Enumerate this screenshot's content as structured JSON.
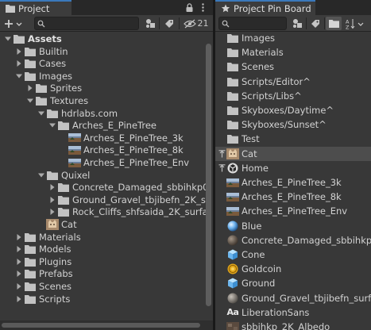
{
  "project": {
    "tab_title": "Project",
    "visibility_count": "21",
    "tree": [
      {
        "label": "Assets",
        "depth": 0,
        "expanded": true,
        "bold": true,
        "icon": "folder"
      },
      {
        "label": "Builtin",
        "depth": 1,
        "expanded": false,
        "icon": "folder"
      },
      {
        "label": "Cases",
        "depth": 1,
        "expanded": false,
        "icon": "folder"
      },
      {
        "label": "Images",
        "depth": 1,
        "expanded": true,
        "icon": "folder"
      },
      {
        "label": "Sprites",
        "depth": 2,
        "expanded": false,
        "icon": "folder"
      },
      {
        "label": "Textures",
        "depth": 2,
        "expanded": true,
        "icon": "folder"
      },
      {
        "label": "hdrlabs.com",
        "depth": 3,
        "expanded": true,
        "icon": "folder"
      },
      {
        "label": "Arches_E_PineTree",
        "depth": 4,
        "expanded": true,
        "icon": "folder"
      },
      {
        "label": "Arches_E_PineTree_3k",
        "depth": 5,
        "icon": "hdr"
      },
      {
        "label": "Arches_E_PineTree_8k",
        "depth": 5,
        "icon": "hdr"
      },
      {
        "label": "Arches_E_PineTree_Env",
        "depth": 5,
        "icon": "hdr"
      },
      {
        "label": "Quixel",
        "depth": 3,
        "expanded": true,
        "icon": "folder"
      },
      {
        "label": "Concrete_Damaged_sbbihkp0",
        "depth": 4,
        "expanded": false,
        "icon": "folder"
      },
      {
        "label": "Ground_Gravel_tbjibefn_2K_su",
        "depth": 4,
        "expanded": false,
        "icon": "folder"
      },
      {
        "label": "Rock_Cliffs_shfsaida_2K_surfa",
        "depth": 4,
        "expanded": false,
        "icon": "folder"
      },
      {
        "label": "Cat",
        "depth": 3,
        "icon": "cat"
      },
      {
        "label": "Materials",
        "depth": 1,
        "expanded": false,
        "icon": "folder"
      },
      {
        "label": "Models",
        "depth": 1,
        "expanded": false,
        "icon": "folder"
      },
      {
        "label": "Plugins",
        "depth": 1,
        "expanded": false,
        "icon": "folder"
      },
      {
        "label": "Prefabs",
        "depth": 1,
        "expanded": false,
        "icon": "folder"
      },
      {
        "label": "Scenes",
        "depth": 1,
        "expanded": false,
        "icon": "folder"
      },
      {
        "label": "Scripts",
        "depth": 1,
        "expanded": false,
        "icon": "folder"
      }
    ]
  },
  "pinboard": {
    "tab_title": "Project Pin Board",
    "items": [
      {
        "label": "Images",
        "icon": "folder"
      },
      {
        "label": "Materials",
        "icon": "folder"
      },
      {
        "label": "Scenes",
        "icon": "folder"
      },
      {
        "label": "Scripts/Editor^",
        "icon": "folder"
      },
      {
        "label": "Scripts/Libs^",
        "icon": "folder"
      },
      {
        "label": "Skyboxes/Daytime^",
        "icon": "folder"
      },
      {
        "label": "Skyboxes/Sunset^",
        "icon": "folder"
      },
      {
        "label": "Test",
        "icon": "folder"
      },
      {
        "label": "Cat",
        "icon": "cat",
        "pinned": true,
        "selected": true
      },
      {
        "label": "Home",
        "icon": "unity",
        "pinned": true
      },
      {
        "label": "Arches_E_PineTree_3k",
        "icon": "hdr"
      },
      {
        "label": "Arches_E_PineTree_8k",
        "icon": "hdr"
      },
      {
        "label": "Arches_E_PineTree_Env",
        "icon": "hdr"
      },
      {
        "label": "Blue",
        "icon": "sphere-blue"
      },
      {
        "label": "Concrete_Damaged_sbbihkp",
        "icon": "sphere-dark"
      },
      {
        "label": "Cone",
        "icon": "cube"
      },
      {
        "label": "Goldcoin",
        "icon": "coin"
      },
      {
        "label": "Ground",
        "icon": "cube"
      },
      {
        "label": "Ground_Gravel_tbjibefn_surfa",
        "icon": "sphere-gray"
      },
      {
        "label": "LiberationSans",
        "icon": "font",
        "glyph": "Aa"
      },
      {
        "label": "sbbihkp_2K_Albedo",
        "icon": "texture"
      }
    ]
  },
  "colors": {
    "accent": "#3a79bb",
    "folder": "#c2c2c2",
    "selection": "#4d4d4d"
  }
}
